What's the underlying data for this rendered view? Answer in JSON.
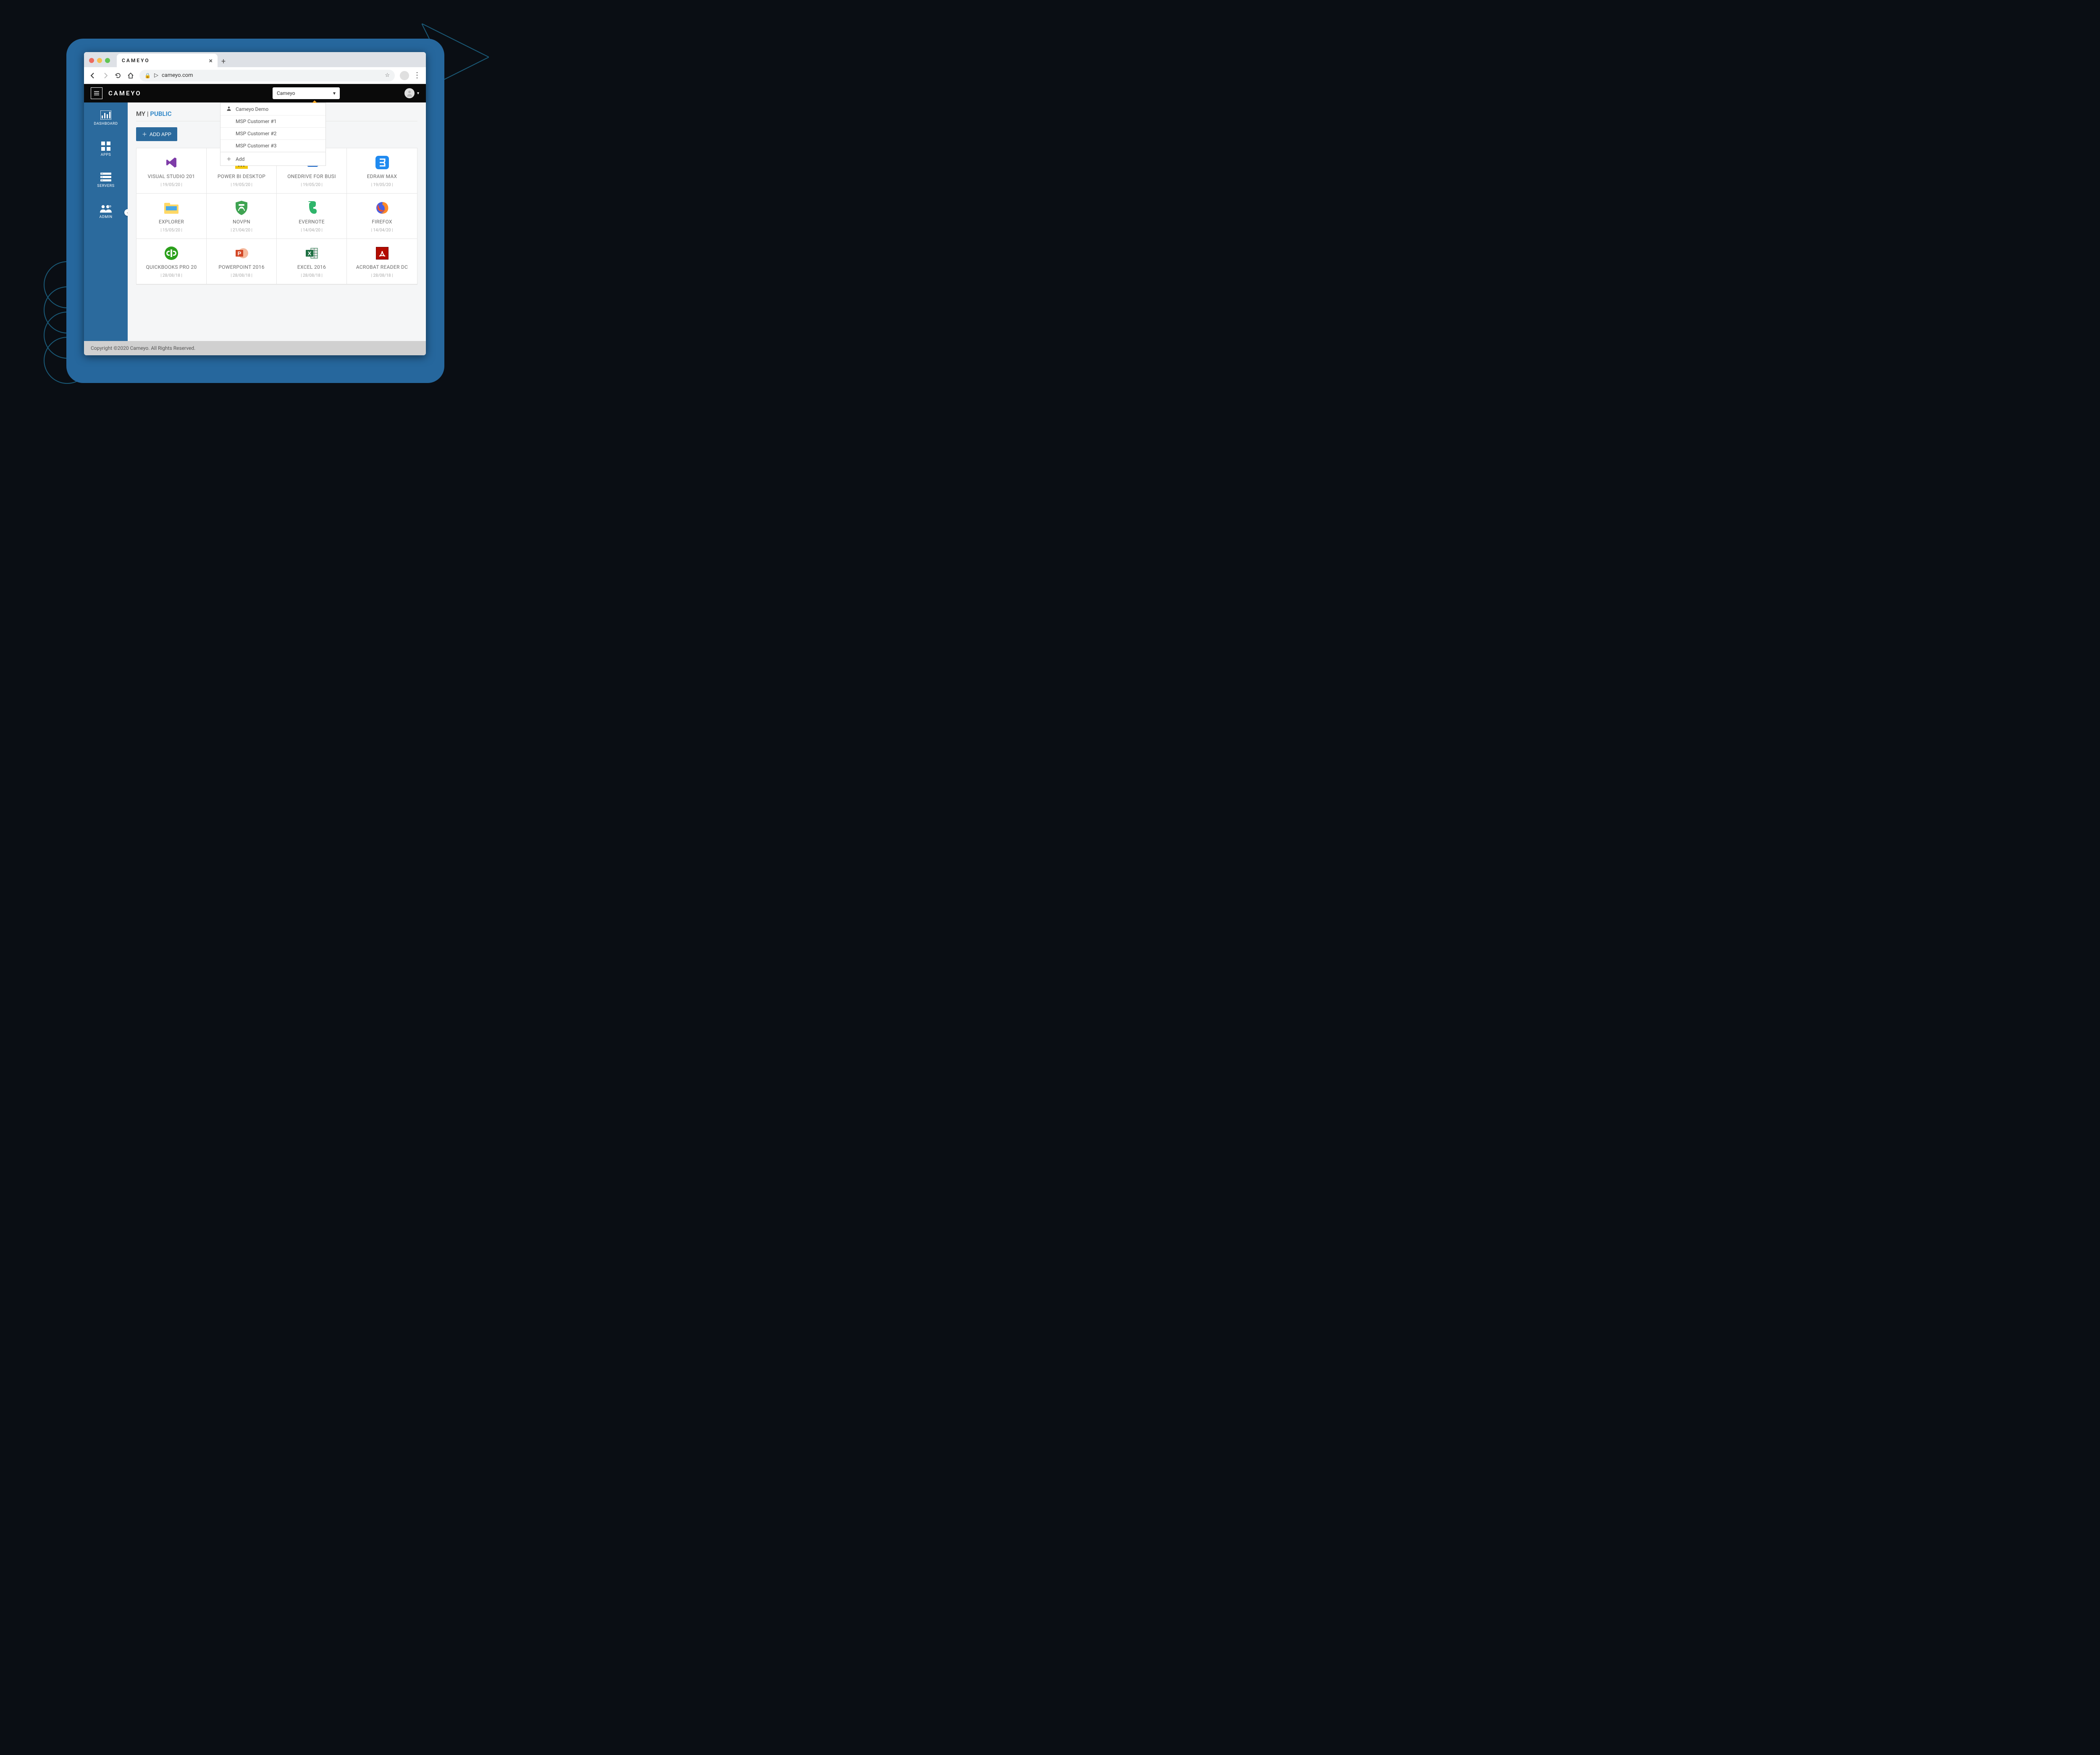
{
  "browser": {
    "tab_title": "CAMEYO",
    "url": "cameyo.com",
    "url_prefix_glyph": "▷"
  },
  "header": {
    "brand": "CAMEYO",
    "tenant_selected": "Cameyo"
  },
  "dropdown": {
    "items": [
      "Cameyo Demo",
      "MSP Customer #1",
      "MSP Customer #2",
      "MSP Customer #3"
    ],
    "add_label": "Add"
  },
  "sidebar": {
    "items": [
      {
        "label": "DASHBOARD",
        "icon": "dashboard"
      },
      {
        "label": "APPS",
        "icon": "apps"
      },
      {
        "label": "SERVERS",
        "icon": "servers"
      },
      {
        "label": "ADMIN",
        "icon": "admin"
      }
    ]
  },
  "main": {
    "breadcrumb_my": "MY",
    "breadcrumb_sep": " | ",
    "breadcrumb_public": "PUBLIC",
    "add_app_label": "ADD APP"
  },
  "apps": [
    {
      "title": "VISUAL STUDIO 201",
      "date": "| 19/05/20 |",
      "icon": "vs"
    },
    {
      "title": "POWER BI DESKTOP",
      "date": "| 19/05/20 |",
      "icon": "powerbi"
    },
    {
      "title": "ONEDRIVE FOR BUSI",
      "date": "| 19/05/20 |",
      "icon": "onedrive"
    },
    {
      "title": "EDRAW MAX",
      "date": "| 19/05/20 |",
      "icon": "edraw"
    },
    {
      "title": "EXPLORER",
      "date": "| 15/05/20 |",
      "icon": "explorer"
    },
    {
      "title": "NOVPN",
      "date": "| 21/04/20 |",
      "icon": "novpn"
    },
    {
      "title": "EVERNOTE",
      "date": "| 14/04/20 |",
      "icon": "evernote"
    },
    {
      "title": "FIREFOX",
      "date": "| 14/04/20 |",
      "icon": "firefox"
    },
    {
      "title": "QUICKBOOKS PRO 20",
      "date": "| 28/08/18 |",
      "icon": "qb"
    },
    {
      "title": "POWERPOINT 2016",
      "date": "| 28/08/18 |",
      "icon": "ppt"
    },
    {
      "title": "EXCEL 2016",
      "date": "| 28/08/18 |",
      "icon": "excel"
    },
    {
      "title": "ACROBAT READER DC",
      "date": "| 28/08/18 |",
      "icon": "acrobat"
    }
  ],
  "footer": {
    "text": "Copyright ©2020 Cameyo. All Rights Reserved."
  }
}
